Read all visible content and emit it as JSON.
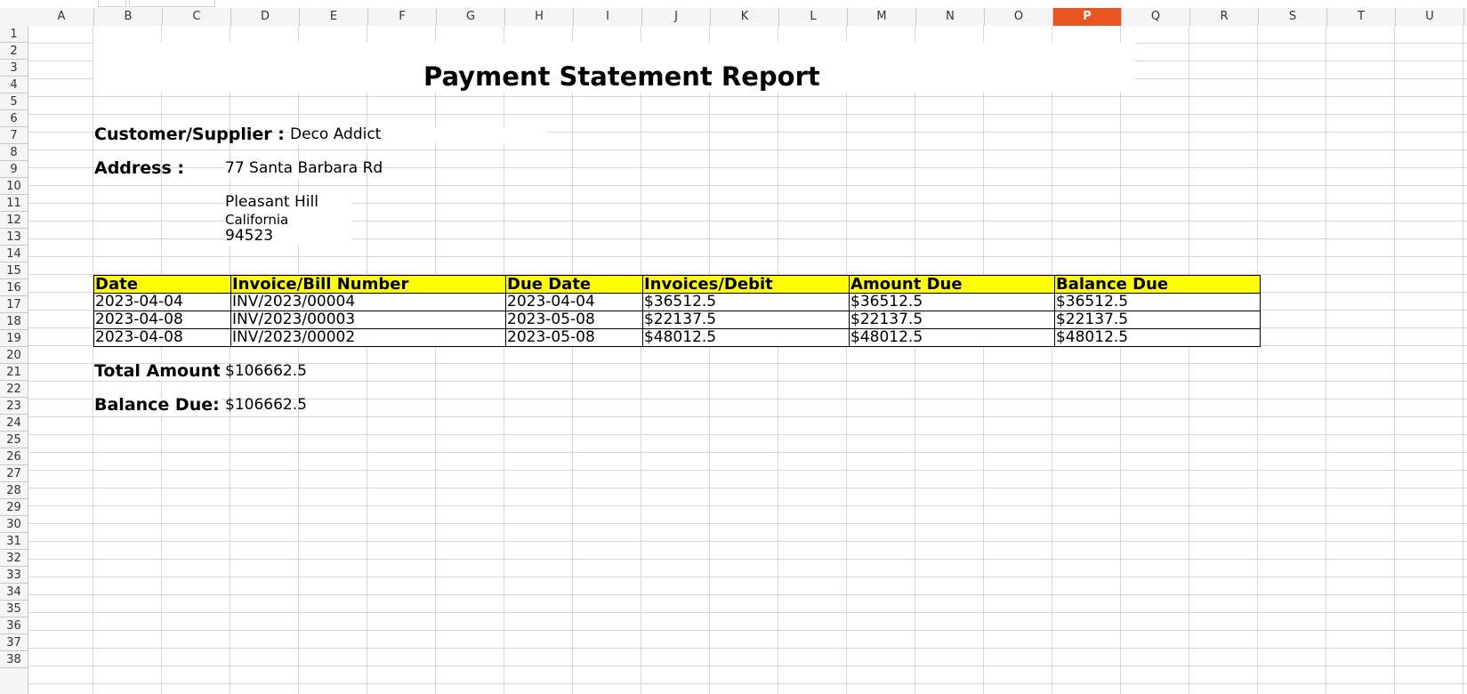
{
  "sheet": {
    "columns": [
      "A",
      "B",
      "C",
      "D",
      "E",
      "F",
      "G",
      "H",
      "I",
      "J",
      "K",
      "L",
      "M",
      "N",
      "O",
      "P",
      "Q",
      "R",
      "S",
      "T",
      "U"
    ],
    "active_column": "P",
    "rows": [
      "1",
      "2",
      "3",
      "4",
      "5",
      "6",
      "7",
      "8",
      "9",
      "10",
      "11",
      "12",
      "13",
      "14",
      "15",
      "16",
      "17",
      "18",
      "19",
      "20",
      "21",
      "22",
      "23",
      "24",
      "25",
      "26",
      "27",
      "28",
      "29",
      "30",
      "31",
      "32",
      "33",
      "34",
      "35",
      "36",
      "37",
      "38"
    ]
  },
  "report": {
    "title": "Payment Statement Report",
    "customer_label": "Customer/Supplier :",
    "customer_value": "Deco Addict",
    "address_label": "Address :",
    "address_line1": "77 Santa Barbara Rd",
    "address_city": "Pleasant Hill",
    "address_state": "California",
    "address_zip": "94523",
    "table": {
      "headers": [
        "Date",
        "Invoice/Bill Number",
        "Due Date",
        "Invoices/Debit",
        "Amount Due",
        "Balance Due"
      ],
      "rows": [
        [
          "2023-04-04",
          "INV/2023/00004",
          "2023-04-04",
          "$36512.5",
          "$36512.5",
          "$36512.5"
        ],
        [
          "2023-04-08",
          "INV/2023/00003",
          "2023-05-08",
          "$22137.5",
          "$22137.5",
          "$22137.5"
        ],
        [
          "2023-04-08",
          "INV/2023/00002",
          "2023-05-08",
          "$48012.5",
          "$48012.5",
          "$48012.5"
        ]
      ]
    },
    "total_label": "Total Amount:",
    "total_value": "$106662.5",
    "balance_label": "Balance Due:",
    "balance_value": "$106662.5"
  },
  "colors": {
    "active_column_header": "#e9541e",
    "table_header_fill": "#ffff00"
  }
}
